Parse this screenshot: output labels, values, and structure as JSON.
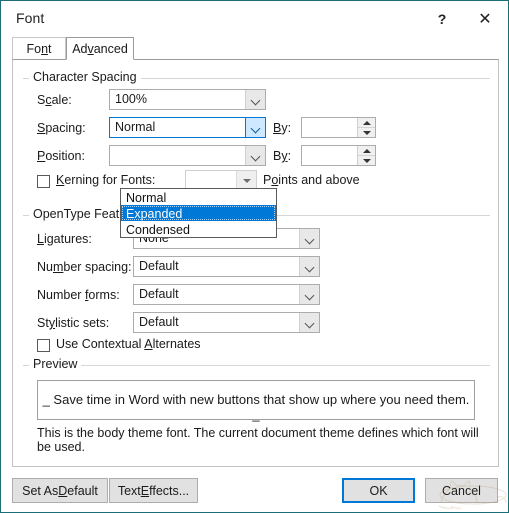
{
  "window": {
    "title": "Font",
    "help_label": "?",
    "close_label": "✕",
    "border_color": "#1b6e78"
  },
  "tabs": [
    {
      "label_pre": "Fo",
      "label_accel": "n",
      "label_post": "t",
      "name": "font",
      "active": false
    },
    {
      "label_pre": "Ad",
      "label_accel": "v",
      "label_post": "anced",
      "name": "advanced",
      "active": true
    }
  ],
  "character_spacing": {
    "group_title": "Character Spacing",
    "scale": {
      "label_pre": "S",
      "label_accel": "c",
      "label_post": "ale:",
      "value": "100%"
    },
    "spacing": {
      "label_pre": "",
      "label_accel": "S",
      "label_post": "pacing:",
      "value": "Normal",
      "options": [
        "Normal",
        "Expanded",
        "Condensed"
      ],
      "selected_option": "Expanded",
      "open": true,
      "highlight_color": "#0078d7"
    },
    "spacing_by": {
      "label_pre": "",
      "label_accel": "B",
      "label_post": "y:",
      "value": ""
    },
    "position": {
      "label_pre": "",
      "label_accel": "P",
      "label_post": "osition:",
      "value": ""
    },
    "position_by": {
      "label_pre": "B",
      "label_accel": "y",
      "label_post": ":",
      "value": ""
    },
    "kerning": {
      "label_pre": "",
      "label_accel": "K",
      "label_post": "erning for Fonts:",
      "checked": false,
      "points_value": "",
      "points_suffix_pre": "P",
      "points_suffix_accel": "o",
      "points_suffix_post": "ints and above"
    }
  },
  "opentype": {
    "group_title": "OpenType Features",
    "rows": [
      {
        "label_pre": "",
        "label_accel": "L",
        "label_post": "igatures:",
        "value": "None",
        "name": "ligatures"
      },
      {
        "label_pre": "Nu",
        "label_accel": "m",
        "label_post": "ber spacing:",
        "value": "Default",
        "name": "number-spacing"
      },
      {
        "label_pre": "Number ",
        "label_accel": "f",
        "label_post": "orms:",
        "value": "Default",
        "name": "number-forms"
      },
      {
        "label_pre": "St",
        "label_accel": "y",
        "label_post": "listic sets:",
        "value": "Default",
        "name": "stylistic-sets"
      }
    ],
    "contextual_alternates": {
      "label_pre": "Use Contextual ",
      "label_accel": "A",
      "label_post": "lternates",
      "checked": false
    }
  },
  "preview": {
    "group_title": "Preview",
    "sample_text": "_ Save time in Word with new buttons that show up where you need them. _",
    "note": "This is the body theme font. The current document theme defines which font will be used."
  },
  "footer": {
    "set_as_default": {
      "pre": "Set As ",
      "accel": "D",
      "post": "efault"
    },
    "text_effects": {
      "pre": "Text ",
      "accel": "E",
      "post": "ffects..."
    },
    "ok": "OK",
    "cancel": "Cancel",
    "default_button_accent": "#0078d7"
  }
}
